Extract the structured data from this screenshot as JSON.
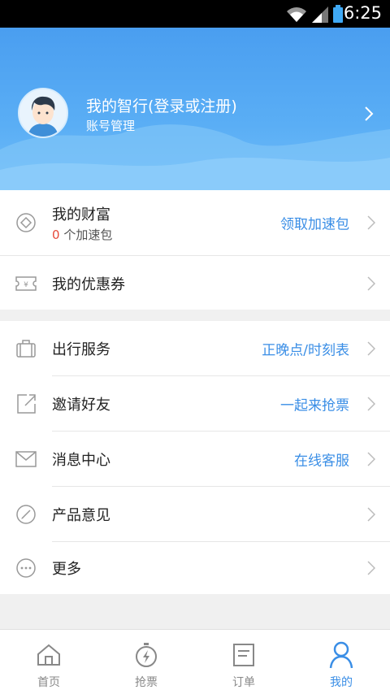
{
  "status_bar": {
    "time": "6:25"
  },
  "profile": {
    "title": "我的智行(登录或注册)",
    "subtitle": "账号管理"
  },
  "wealth": {
    "label": "我的财富",
    "count": "0",
    "count_suffix": " 个加速包",
    "action": "领取加速包"
  },
  "coupons": {
    "label": "我的优惠券"
  },
  "menu": [
    {
      "label": "出行服务",
      "value": "正晚点/时刻表"
    },
    {
      "label": "邀请好友",
      "value": "一起来抢票"
    },
    {
      "label": "消息中心",
      "value": "在线客服"
    },
    {
      "label": "产品意见",
      "value": ""
    },
    {
      "label": "更多",
      "value": ""
    }
  ],
  "tabs": [
    {
      "label": "首页"
    },
    {
      "label": "抢票"
    },
    {
      "label": "订单"
    },
    {
      "label": "我的"
    }
  ],
  "colors": {
    "accent": "#3a8ee6",
    "header": "#4a9ef0",
    "alert": "#e64a3b"
  }
}
